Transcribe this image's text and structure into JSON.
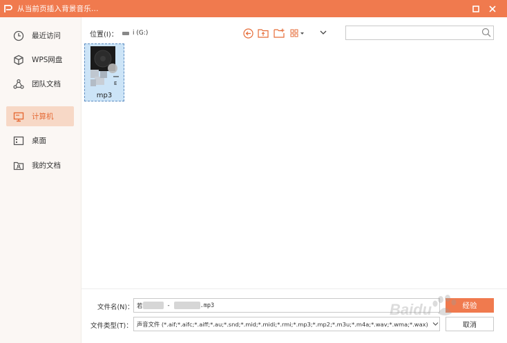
{
  "window": {
    "title": "从当前页插入背景音乐..."
  },
  "sidebar": {
    "items": [
      {
        "label": "最近访问",
        "icon": "clock-icon"
      },
      {
        "label": "WPS网盘",
        "icon": "cloud-box-icon"
      },
      {
        "label": "团队文档",
        "icon": "team-icon"
      },
      {
        "label": "计算机",
        "icon": "computer-icon",
        "active": true
      },
      {
        "label": "桌面",
        "icon": "desktop-icon"
      },
      {
        "label": "我的文档",
        "icon": "my-documents-icon"
      }
    ]
  },
  "toolbar": {
    "location_label": "位置(I)：",
    "location_value": "i (G:)",
    "buttons": [
      "back-icon",
      "up-folder-icon",
      "new-folder-icon",
      "view-mode-icon"
    ]
  },
  "search": {
    "placeholder": ""
  },
  "files": [
    {
      "name": "mp3",
      "partial_label": "E"
    }
  ],
  "footer": {
    "filename_label": "文件名(N)：",
    "filename_prefix": "若",
    "filename_dash": "-",
    "filename_ext": ".mp3",
    "filetype_label": "文件类型(T)：",
    "filetype_value": "声音文件 (*.aif;*.aifc;*.aiff;*.au;*.snd;*.mid;*.midi;*.rmi;*.mp3;*.mp2;*.m3u;*.m4a;*.wav;*.wma;*.wax)",
    "ok_label": "经验",
    "cancel_label": "取消"
  },
  "watermark": {
    "text": "Baidu"
  },
  "colors": {
    "accent": "#f07a4e",
    "active_bg": "#f7d8c6",
    "active_text": "#e56a35",
    "sidebar_bg": "#fbf7f4",
    "selection": "#cce4f7"
  }
}
